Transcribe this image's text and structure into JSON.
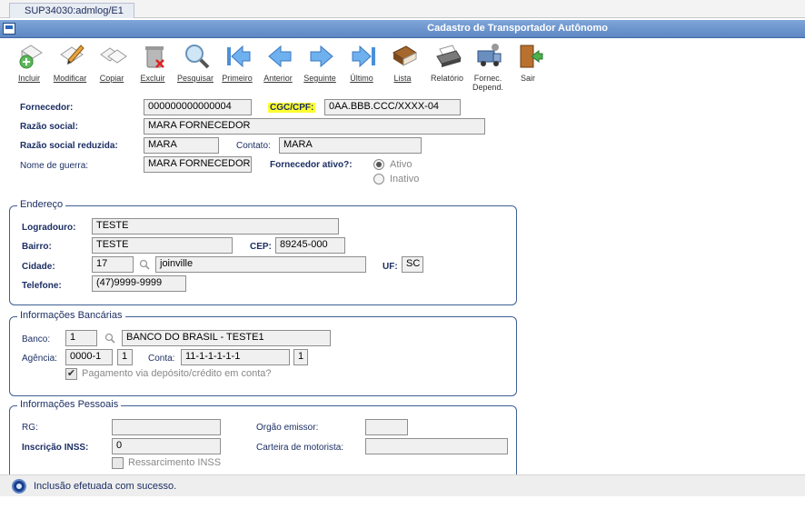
{
  "tab": {
    "label": "SUP34030:admlog/E1"
  },
  "window": {
    "title": "Cadastro de Transportador Autônomo"
  },
  "toolbar": {
    "incluir": "Incluir",
    "modificar": "Modificar",
    "copiar": "Copiar",
    "excluir": "Excluir",
    "pesquisar": "Pesquisar",
    "primeiro": "Primeiro",
    "anterior": "Anterior",
    "seguinte": "Seguinte",
    "ultimo": "Último",
    "lista": "Lista",
    "relatorio": "Relatório",
    "fornec_line1": "Fornec.",
    "fornec_line2": "Depend.",
    "sair": "Sair"
  },
  "fornecedor": {
    "fornecedor_label": "Fornecedor:",
    "fornecedor_value": "000000000000004",
    "cgc_label": "CGC/CPF:",
    "cgc_value": "0AA.BBB.CCC/XXXX-04",
    "razao_label": "Razão social:",
    "razao_value": "MARA FORNECEDOR",
    "razao_reduzida_label": "Razão social reduzida:",
    "razao_reduzida_value": "MARA",
    "contato_label": "Contato:",
    "contato_value": "MARA",
    "guerra_label": "Nome de guerra:",
    "guerra_value": "MARA FORNECEDOR",
    "ativo_label": "Fornecedor ativo?:",
    "ativo_option": "Ativo",
    "inativo_option": "Inativo",
    "ativo_selected": "Ativo"
  },
  "endereco": {
    "legend": "Endereço",
    "logradouro_label": "Logradouro:",
    "logradouro_value": "TESTE",
    "bairro_label": "Bairro:",
    "bairro_value": "TESTE",
    "cep_label": "CEP:",
    "cep_value": "89245-000",
    "cidade_label": "Cidade:",
    "cidade_code": "17",
    "cidade_name": "joinville",
    "uf_label": "UF:",
    "uf_value": "SC",
    "telefone_label": "Telefone:",
    "telefone_value": "(47)9999-9999"
  },
  "bancarias": {
    "legend": "Informações Bancárias",
    "banco_label": "Banco:",
    "banco_code": "1",
    "banco_name": "BANCO DO BRASIL - TESTE1",
    "agencia_label": "Agência:",
    "agencia_value": "0000-1",
    "agencia_dv": "1",
    "conta_label": "Conta:",
    "conta_value": "11-1-1-1-1-1",
    "conta_dv": "1",
    "pagamento_label": "Pagamento via depósito/crédito em conta?",
    "pagamento_check": "✔"
  },
  "pessoais": {
    "legend": "Informações Pessoais",
    "rg_label": "RG:",
    "rg_value": "",
    "orgao_label": "Orgão emissor:",
    "orgao_value": "",
    "inss_label": "Inscrição INSS:",
    "inss_value": "0",
    "carteira_label": "Carteira de motorista:",
    "carteira_value": "",
    "ressarcimento_label": "Ressarcimento INSS"
  },
  "status": {
    "message": "Inclusão efetuada com sucesso."
  }
}
